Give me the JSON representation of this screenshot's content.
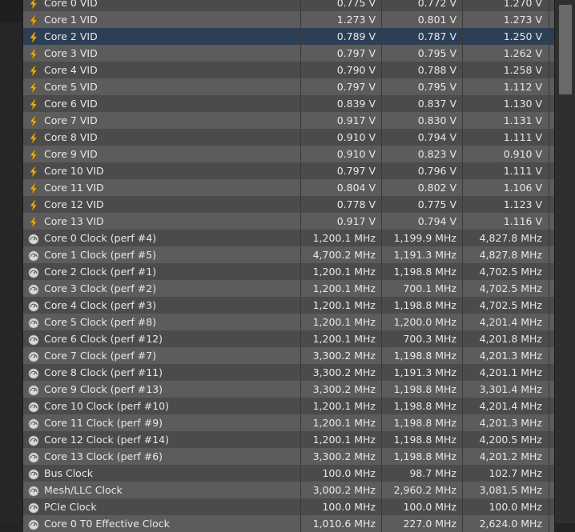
{
  "colors": {
    "row_odd": "#4b4b4b",
    "row_even": "#5c5c5c",
    "row_selected": "#2d3f55",
    "text": "#e8e8e8",
    "bolt_icon": "#f2b320",
    "clock_icon": "#d9d9d9"
  },
  "rows": [
    {
      "name": "Core 0 VID",
      "icon": "lightning-bolt-icon",
      "v1": "0.775 V",
      "v2": "0.772 V",
      "v3": "1.270 V"
    },
    {
      "name": "Core 1 VID",
      "icon": "lightning-bolt-icon",
      "v1": "1.273 V",
      "v2": "0.801 V",
      "v3": "1.273 V"
    },
    {
      "name": "Core 2 VID",
      "icon": "lightning-bolt-icon",
      "v1": "0.789 V",
      "v2": "0.787 V",
      "v3": "1.250 V",
      "selected": true
    },
    {
      "name": "Core 3 VID",
      "icon": "lightning-bolt-icon",
      "v1": "0.797 V",
      "v2": "0.795 V",
      "v3": "1.262 V"
    },
    {
      "name": "Core 4 VID",
      "icon": "lightning-bolt-icon",
      "v1": "0.790 V",
      "v2": "0.788 V",
      "v3": "1.258 V"
    },
    {
      "name": "Core 5 VID",
      "icon": "lightning-bolt-icon",
      "v1": "0.797 V",
      "v2": "0.795 V",
      "v3": "1.112 V"
    },
    {
      "name": "Core 6 VID",
      "icon": "lightning-bolt-icon",
      "v1": "0.839 V",
      "v2": "0.837 V",
      "v3": "1.130 V"
    },
    {
      "name": "Core 7 VID",
      "icon": "lightning-bolt-icon",
      "v1": "0.917 V",
      "v2": "0.830 V",
      "v3": "1.131 V"
    },
    {
      "name": "Core 8 VID",
      "icon": "lightning-bolt-icon",
      "v1": "0.910 V",
      "v2": "0.794 V",
      "v3": "1.111 V"
    },
    {
      "name": "Core 9 VID",
      "icon": "lightning-bolt-icon",
      "v1": "0.910 V",
      "v2": "0.823 V",
      "v3": "0.910 V"
    },
    {
      "name": "Core 10 VID",
      "icon": "lightning-bolt-icon",
      "v1": "0.797 V",
      "v2": "0.796 V",
      "v3": "1.111 V"
    },
    {
      "name": "Core 11 VID",
      "icon": "lightning-bolt-icon",
      "v1": "0.804 V",
      "v2": "0.802 V",
      "v3": "1.106 V"
    },
    {
      "name": "Core 12 VID",
      "icon": "lightning-bolt-icon",
      "v1": "0.778 V",
      "v2": "0.775 V",
      "v3": "1.123 V"
    },
    {
      "name": "Core 13 VID",
      "icon": "lightning-bolt-icon",
      "v1": "0.917 V",
      "v2": "0.794 V",
      "v3": "1.116 V"
    },
    {
      "name": "Core 0 Clock (perf #4)",
      "icon": "clock-gauge-icon",
      "v1": "1,200.1 MHz",
      "v2": "1,199.9 MHz",
      "v3": "4,827.8 MHz"
    },
    {
      "name": "Core 1 Clock (perf #5)",
      "icon": "clock-gauge-icon",
      "v1": "4,700.2 MHz",
      "v2": "1,191.3 MHz",
      "v3": "4,827.8 MHz"
    },
    {
      "name": "Core 2 Clock (perf #1)",
      "icon": "clock-gauge-icon",
      "v1": "1,200.1 MHz",
      "v2": "1,198.8 MHz",
      "v3": "4,702.5 MHz"
    },
    {
      "name": "Core 3 Clock (perf #2)",
      "icon": "clock-gauge-icon",
      "v1": "1,200.1 MHz",
      "v2": "700.1 MHz",
      "v3": "4,702.5 MHz"
    },
    {
      "name": "Core 4 Clock (perf #3)",
      "icon": "clock-gauge-icon",
      "v1": "1,200.1 MHz",
      "v2": "1,198.8 MHz",
      "v3": "4,702.5 MHz"
    },
    {
      "name": "Core 5 Clock (perf #8)",
      "icon": "clock-gauge-icon",
      "v1": "1,200.1 MHz",
      "v2": "1,200.0 MHz",
      "v3": "4,201.4 MHz"
    },
    {
      "name": "Core 6 Clock (perf #12)",
      "icon": "clock-gauge-icon",
      "v1": "1,200.1 MHz",
      "v2": "700.3 MHz",
      "v3": "4,201.8 MHz"
    },
    {
      "name": "Core 7 Clock (perf #7)",
      "icon": "clock-gauge-icon",
      "v1": "3,300.2 MHz",
      "v2": "1,198.8 MHz",
      "v3": "4,201.3 MHz"
    },
    {
      "name": "Core 8 Clock (perf #11)",
      "icon": "clock-gauge-icon",
      "v1": "3,300.2 MHz",
      "v2": "1,191.3 MHz",
      "v3": "4,201.1 MHz"
    },
    {
      "name": "Core 9 Clock (perf #13)",
      "icon": "clock-gauge-icon",
      "v1": "3,300.2 MHz",
      "v2": "1,198.8 MHz",
      "v3": "3,301.4 MHz"
    },
    {
      "name": "Core 10 Clock (perf #10)",
      "icon": "clock-gauge-icon",
      "v1": "1,200.1 MHz",
      "v2": "1,198.8 MHz",
      "v3": "4,201.4 MHz"
    },
    {
      "name": "Core 11 Clock (perf #9)",
      "icon": "clock-gauge-icon",
      "v1": "1,200.1 MHz",
      "v2": "1,198.8 MHz",
      "v3": "4,201.3 MHz"
    },
    {
      "name": "Core 12 Clock (perf #14)",
      "icon": "clock-gauge-icon",
      "v1": "1,200.1 MHz",
      "v2": "1,198.8 MHz",
      "v3": "4,200.5 MHz"
    },
    {
      "name": "Core 13 Clock (perf #6)",
      "icon": "clock-gauge-icon",
      "v1": "3,300.2 MHz",
      "v2": "1,198.8 MHz",
      "v3": "4,201.2 MHz"
    },
    {
      "name": "Bus Clock",
      "icon": "clock-gauge-icon",
      "v1": "100.0 MHz",
      "v2": "98.7 MHz",
      "v3": "102.7 MHz"
    },
    {
      "name": "Mesh/LLC Clock",
      "icon": "clock-gauge-icon",
      "v1": "3,000.2 MHz",
      "v2": "2,960.2 MHz",
      "v3": "3,081.5 MHz"
    },
    {
      "name": "PCIe Clock",
      "icon": "clock-gauge-icon",
      "v1": "100.0 MHz",
      "v2": "100.0 MHz",
      "v3": "100.0 MHz"
    },
    {
      "name": "Core 0 T0 Effective Clock",
      "icon": "clock-gauge-icon",
      "v1": "1,010.6 MHz",
      "v2": "227.0 MHz",
      "v3": "2,624.0 MHz"
    }
  ]
}
